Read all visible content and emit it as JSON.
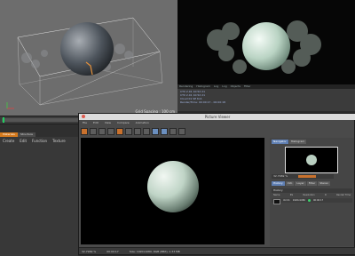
{
  "viewport": {
    "status_text": "Grid Spacing : 100 cm"
  },
  "render_log": {
    "tabs": [
      "Rendering",
      "Histogram",
      "Log",
      "Log",
      "Objects",
      "Filter"
    ],
    "lines": [
      "CTX 2.01 10:52 21",
      "CTX 2.01 10:52 21",
      "Cloud 01 SE  tint.",
      "Render/Time: 00:00:17 - 00:00:18"
    ]
  },
  "material_manager": {
    "tabs": [
      "Materials",
      "Structure"
    ],
    "menu": [
      "Create",
      "Edit",
      "Function",
      "Texture"
    ]
  },
  "picture_viewer": {
    "title": "Picture Viewer",
    "menu": [
      "File",
      "Edit",
      "View",
      "Compare",
      "Animation"
    ],
    "status": {
      "zoom": "32.7969 %",
      "time": "00:00:17",
      "size": "Size: 1920x1080, RGB (8Bit), 1.33 MB"
    },
    "sidebar": {
      "tabs": [
        "Navigator",
        "Histogram"
      ],
      "zoom_label": "32.7969 %",
      "history_tabs": [
        "History",
        "Info",
        "Layer",
        "Filter",
        "Stereo"
      ],
      "history_title": "History",
      "history_columns": [
        "Name",
        "RS",
        "Resolution",
        "R",
        "Render Time"
      ],
      "history_row": {
        "name": "Vol 01",
        "resolution": "1920x1080",
        "time": "00:00:17"
      }
    }
  },
  "colors": {
    "accent_orange": "#d67a1d",
    "accent_blue": "#5f7fb3",
    "status_green": "#20d060"
  }
}
